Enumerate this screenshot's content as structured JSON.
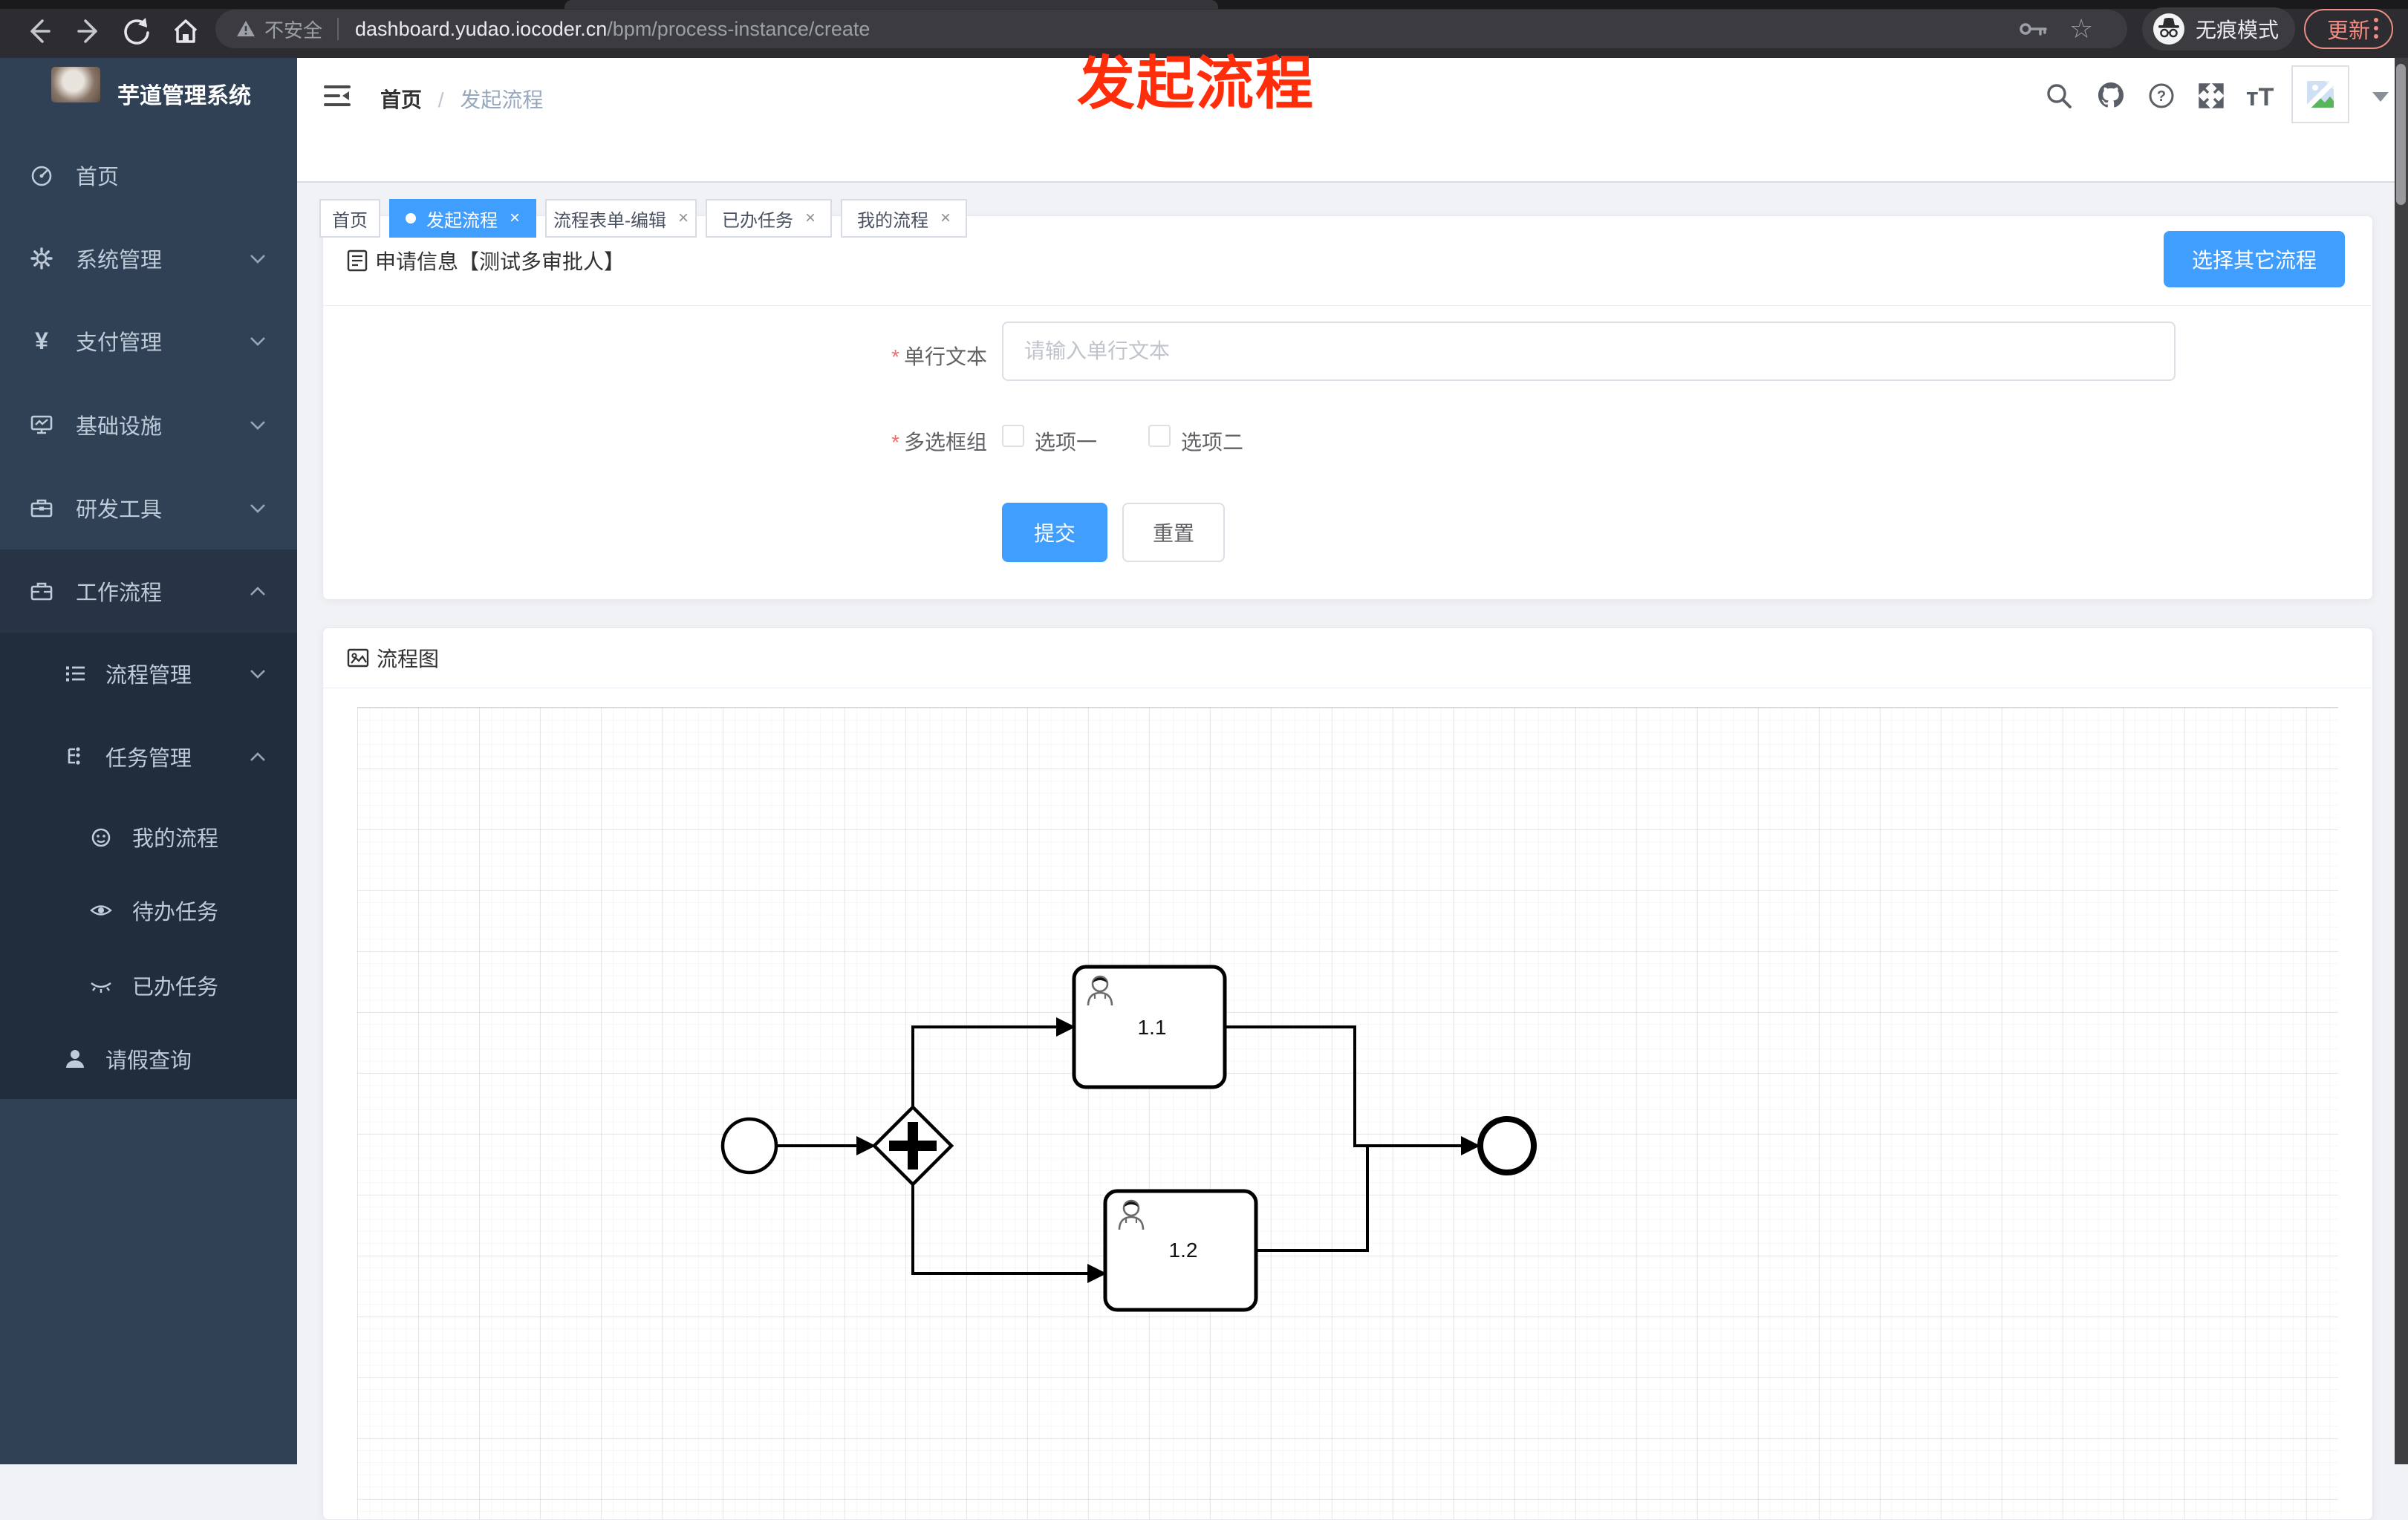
{
  "browser": {
    "security_label": "不安全",
    "url_host": "dashboard.yudao.iocoder.cn",
    "url_path": "/bpm/process-instance/create",
    "incognito_label": "无痕模式",
    "update_label": "更新"
  },
  "sidebar": {
    "title": "芋道管理系统",
    "items": [
      {
        "label": "首页",
        "icon": "dashboard-icon"
      },
      {
        "label": "系统管理",
        "icon": "gear-icon",
        "expandable": true
      },
      {
        "label": "支付管理",
        "icon": "yen-icon",
        "expandable": true
      },
      {
        "label": "基础设施",
        "icon": "monitor-icon",
        "expandable": true
      },
      {
        "label": "研发工具",
        "icon": "toolbox-icon",
        "expandable": true
      },
      {
        "label": "工作流程",
        "icon": "briefcase-icon",
        "expandable": true,
        "expanded": true
      },
      {
        "label": "流程管理",
        "icon": "list-icon",
        "expandable": true,
        "level": 2
      },
      {
        "label": "任务管理",
        "icon": "tree-icon",
        "expandable": true,
        "expanded": true,
        "level": 2
      },
      {
        "label": "我的流程",
        "icon": "robot-face-icon",
        "level": 3
      },
      {
        "label": "待办任务",
        "icon": "eye-open-icon",
        "level": 3
      },
      {
        "label": "已办任务",
        "icon": "eye-closed-icon",
        "level": 3
      },
      {
        "label": "请假查询",
        "icon": "user-icon",
        "level": 2
      }
    ]
  },
  "header": {
    "breadcrumb": [
      "首页",
      "发起流程"
    ],
    "breadcrumb_separator": "/"
  },
  "tabs": [
    {
      "label": "首页",
      "active": false,
      "closable": false
    },
    {
      "label": "发起流程",
      "active": true,
      "closable": true
    },
    {
      "label": "流程表单-编辑",
      "active": false,
      "closable": true
    },
    {
      "label": "已办任务",
      "active": false,
      "closable": true
    },
    {
      "label": "我的流程",
      "active": false,
      "closable": true
    }
  ],
  "ui": {
    "close_glyph": "×",
    "star_glyph": "☆",
    "question_glyph": "?",
    "yen_glyph": "¥",
    "font_size_glyph": "тT"
  },
  "annotation": {
    "text": "发起流程",
    "color": "#ff2d0a"
  },
  "form_card": {
    "title": "申请信息【测试多审批人】",
    "choose_other_button": "选择其它流程",
    "required_mark": "*",
    "fields": [
      {
        "label": "单行文本",
        "required": true,
        "placeholder": "请输入单行文本",
        "value": ""
      },
      {
        "label": "多选框组",
        "required": true,
        "options": [
          {
            "label": "选项一",
            "checked": false
          },
          {
            "label": "选项二",
            "checked": false
          }
        ]
      }
    ],
    "submit_label": "提交",
    "reset_label": "重置"
  },
  "diagram_card": {
    "title": "流程图",
    "nodes": [
      {
        "type": "startEvent",
        "label": ""
      },
      {
        "type": "parallelGateway",
        "label": ""
      },
      {
        "type": "userTask",
        "label": "1.1"
      },
      {
        "type": "userTask",
        "label": "1.2"
      },
      {
        "type": "endEvent",
        "label": ""
      }
    ]
  },
  "colors": {
    "primary": "#409eff",
    "sidebar_bg": "#304156",
    "sidebar_submenu_bg": "#1f2d3d",
    "sidebar_text": "#bfcbd9",
    "annotation_red": "#ff2d0a",
    "update_button_red": "#f28b82"
  }
}
